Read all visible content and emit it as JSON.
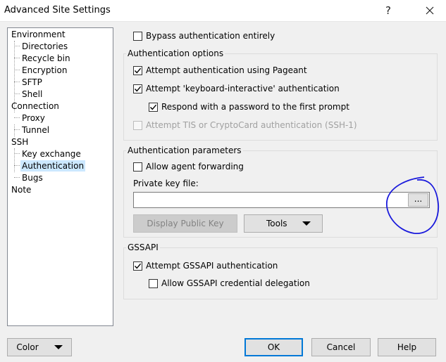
{
  "window": {
    "title": "Advanced Site Settings",
    "help_glyph": "?"
  },
  "tree": {
    "items": [
      {
        "label": "Environment"
      },
      {
        "label": "Directories"
      },
      {
        "label": "Recycle bin"
      },
      {
        "label": "Encryption"
      },
      {
        "label": "SFTP"
      },
      {
        "label": "Shell"
      },
      {
        "label": "Connection"
      },
      {
        "label": "Proxy"
      },
      {
        "label": "Tunnel"
      },
      {
        "label": "SSH"
      },
      {
        "label": "Key exchange"
      },
      {
        "label": "Authentication",
        "selected": true
      },
      {
        "label": "Bugs"
      },
      {
        "label": "Note"
      }
    ]
  },
  "auth": {
    "bypass": {
      "label": "Bypass authentication entirely",
      "checked": false
    },
    "options_group": "Authentication options",
    "pageant": {
      "label": "Attempt authentication using Pageant",
      "checked": true
    },
    "kbd_interactive": {
      "label": "Attempt 'keyboard-interactive' authentication",
      "checked": true
    },
    "respond_password": {
      "label": "Respond with a password to the first prompt",
      "checked": true
    },
    "tis": {
      "label": "Attempt TIS or CryptoCard authentication (SSH-1)",
      "checked": false,
      "disabled": true
    },
    "params_group": "Authentication parameters",
    "agent_forwarding": {
      "label": "Allow agent forwarding",
      "checked": false
    },
    "private_key_label": "Private key file:",
    "private_key_value": "",
    "browse_label": "...",
    "display_public_key": "Display Public Key",
    "tools": "Tools",
    "gssapi_group": "GSSAPI",
    "gssapi_attempt": {
      "label": "Attempt GSSAPI authentication",
      "checked": true
    },
    "gssapi_delegation": {
      "label": "Allow GSSAPI credential delegation",
      "checked": false
    }
  },
  "footer": {
    "color": "Color",
    "ok": "OK",
    "cancel": "Cancel",
    "help": "Help"
  },
  "colors": {
    "selection": "#cce8ff",
    "default_button_border": "#0078d7",
    "annotation": "#1a1adc"
  },
  "icons": {
    "check": "check-icon",
    "close": "close-icon",
    "dropdown": "dropdown-arrow-icon"
  }
}
